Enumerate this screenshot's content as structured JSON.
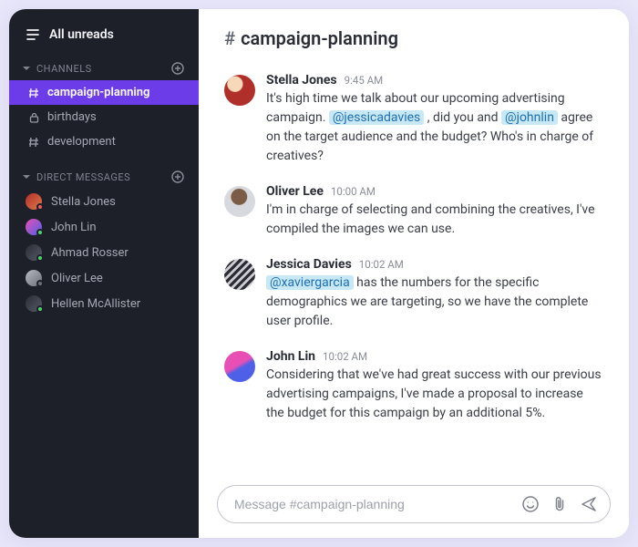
{
  "sidebar": {
    "all_unreads_label": "All unreads",
    "channels_header": "CHANNELS",
    "dm_header": "DIRECT MESSAGES",
    "channels": [
      {
        "name": "campaign-planning",
        "icon": "hash",
        "active": true
      },
      {
        "name": "birthdays",
        "icon": "lock",
        "active": false
      },
      {
        "name": "development",
        "icon": "hash",
        "active": false
      }
    ],
    "dms": [
      {
        "name": "Stella Jones",
        "avatar_bg": "linear-gradient(135deg,#b02f2a,#e07a4a)",
        "presence": "#f15a63"
      },
      {
        "name": "John Lin",
        "avatar_bg": "linear-gradient(135deg,#e84fb5,#4f60e8)",
        "presence": "#4bd66b"
      },
      {
        "name": "Ahmad Rosser",
        "avatar_bg": "linear-gradient(135deg,#2a2c34,#575a66)",
        "presence": "#4bd66b"
      },
      {
        "name": "Oliver Lee",
        "avatar_bg": "linear-gradient(135deg,#b7b9c2,#6e7078)",
        "presence": "#6c6f79"
      },
      {
        "name": "Hellen McAllister",
        "avatar_bg": "linear-gradient(135deg,#2a2c34,#575a66)",
        "presence": "#4bd66b"
      }
    ]
  },
  "channel": {
    "name": "campaign-planning",
    "composer_placeholder": "Message #campaign-planning"
  },
  "messages": [
    {
      "author": "Stella Jones",
      "time": "9:45 AM",
      "avatar_bg": "radial-gradient(circle at 35% 30%, #f7d8b9 25%, #b02f2a 28%)",
      "segments": [
        {
          "t": "text",
          "v": "It's high time we talk about our upcoming advertising campaign. "
        },
        {
          "t": "mention",
          "v": "@jessicadavies"
        },
        {
          "t": "text",
          "v": " , did you and "
        },
        {
          "t": "mention",
          "v": "@johnlin"
        },
        {
          "t": "text",
          "v": "  agree on the target audience and the budget? Who's in charge of creatives?"
        }
      ]
    },
    {
      "author": "Oliver Lee",
      "time": "10:00 AM",
      "avatar_bg": "radial-gradient(circle at 48% 35%, #7a5c47 30%, #d7d9de 33%)",
      "segments": [
        {
          "t": "text",
          "v": "I'm in charge of selecting and combining the creatives, I've compiled the images we can use."
        }
      ]
    },
    {
      "author": "Jessica Davies",
      "time": "10:02 AM",
      "avatar_bg": "repeating-linear-gradient(135deg,#2b2c33 0 3px,#ccccd2 3px 6px)",
      "segments": [
        {
          "t": "mention",
          "v": "@xaviergarcia"
        },
        {
          "t": "text",
          "v": "  has the numbers for the specific demographics we are targeting, so we have the complete user profile."
        }
      ]
    },
    {
      "author": "John Lin",
      "time": "10:02 AM",
      "avatar_bg": "linear-gradient(150deg,#e84fb5 0 45%, #4f60e8 55% 100%)",
      "segments": [
        {
          "t": "text",
          "v": "Considering that we've had great success with our previous advertising campaigns, I've made a proposal to increase the budget for this campaign by an additional 5%."
        }
      ]
    }
  ]
}
